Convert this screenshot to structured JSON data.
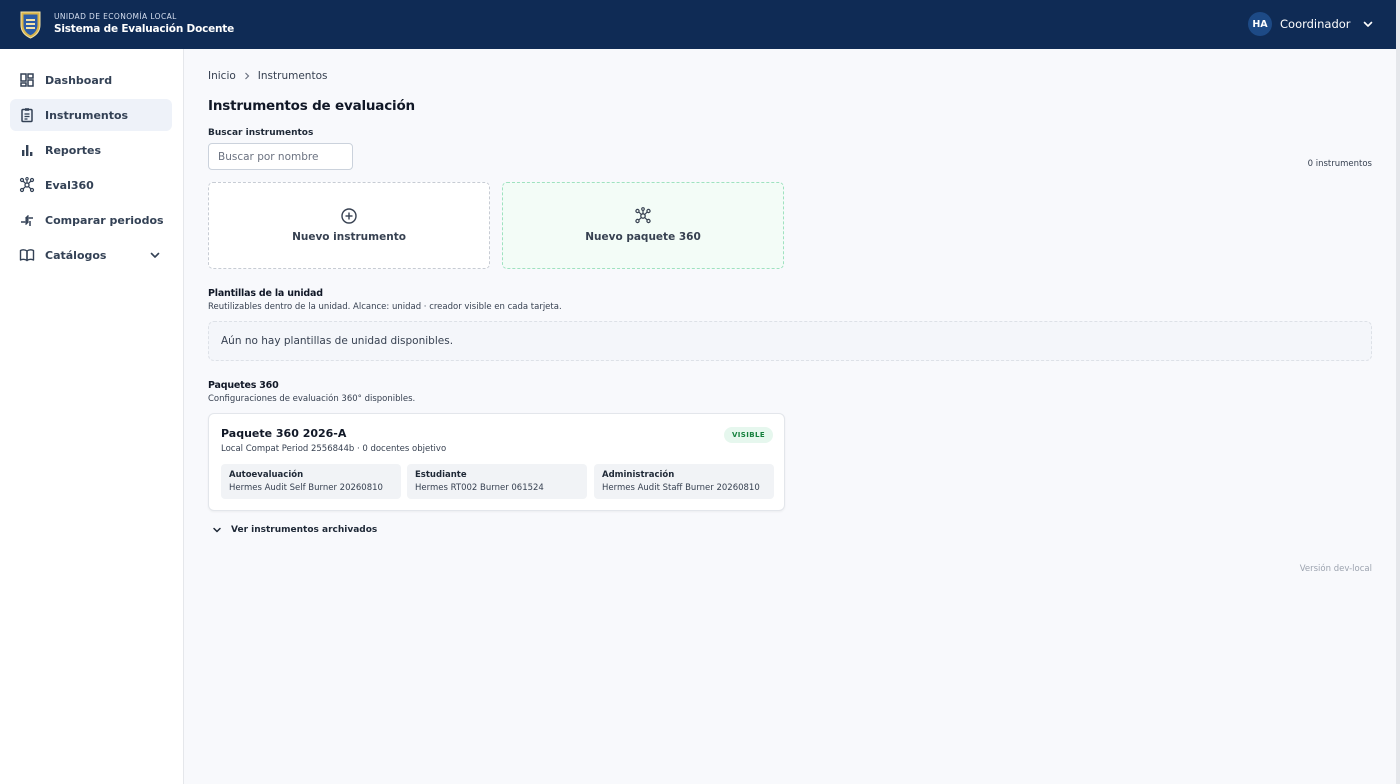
{
  "header": {
    "org": "UNIDAD DE ECONOMÍA LOCAL",
    "app_title": "Sistema de Evaluación Docente",
    "user_initials": "HA",
    "user_role": "Coordinador"
  },
  "sidebar": {
    "items": [
      {
        "label": "Dashboard",
        "icon": "dashboard-icon"
      },
      {
        "label": "Instrumentos",
        "icon": "clipboard-icon",
        "active": true
      },
      {
        "label": "Reportes",
        "icon": "bar-chart-icon"
      },
      {
        "label": "Eval360",
        "icon": "network-icon"
      },
      {
        "label": "Comparar periodos",
        "icon": "compare-arrows-icon"
      },
      {
        "label": "Catálogos",
        "icon": "book-icon",
        "expandable": true
      }
    ]
  },
  "breadcrumb": {
    "home": "Inicio",
    "current": "Instrumentos"
  },
  "page": {
    "title": "Instrumentos de evaluación"
  },
  "search": {
    "label": "Buscar instrumentos",
    "placeholder": "Buscar por nombre",
    "value": ""
  },
  "count": "0 instrumentos",
  "create": {
    "new_instrument": "Nuevo instrumento",
    "new_package": "Nuevo paquete 360"
  },
  "templates": {
    "title": "Plantillas de la unidad",
    "subtitle": "Reutilizables dentro de la unidad. Alcance: unidad · creador visible en cada tarjeta.",
    "empty": "Aún no hay plantillas de unidad disponibles."
  },
  "packages": {
    "title": "Paquetes 360",
    "subtitle": "Configuraciones de evaluación 360° disponibles.",
    "items": [
      {
        "name": "Paquete 360 2026-A",
        "meta": "Local Compat Period 2556844b · 0 docentes objetivo",
        "badge": "VISIBLE",
        "roles": [
          {
            "title": "Autoevaluación",
            "instrument": "Hermes Audit Self Burner 20260810"
          },
          {
            "title": "Estudiante",
            "instrument": "Hermes RT002 Burner 061524"
          },
          {
            "title": "Administración",
            "instrument": "Hermes Audit Staff Burner 20260810"
          }
        ]
      }
    ]
  },
  "archived": {
    "label": "Ver instrumentos archivados"
  },
  "version": "Versión dev-local",
  "colors": {
    "header_bg": "#0f2b55",
    "accent_green": "#15803d",
    "active_nav": "#eef2f9"
  }
}
